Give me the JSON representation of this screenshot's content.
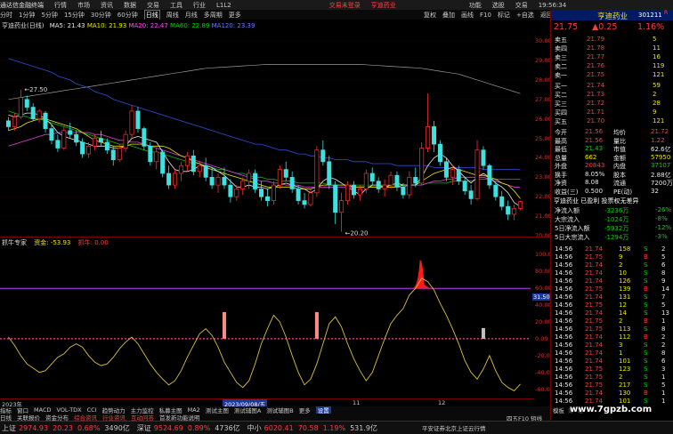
{
  "menubar": {
    "app": "通达信金融终端",
    "items": [
      "行情",
      "市场",
      "资讯",
      "数据",
      "交易",
      "工具",
      "行业",
      "L1L2"
    ],
    "center": "交易未登录",
    "center2": "亨迪药业",
    "right": [
      "功能",
      "选股",
      "交易"
    ],
    "clock": "19:56:34"
  },
  "toolbar": {
    "items": [
      "分时",
      "1分钟",
      "5分钟",
      "15分钟",
      "30分钟",
      "60分钟",
      "日线",
      "周线",
      "月线",
      "多周期",
      "更多"
    ],
    "active": "日线"
  },
  "toolbar2": {
    "items": [
      "复权",
      "叠加",
      "画线",
      "F10",
      "标记",
      "+自选",
      "返回"
    ]
  },
  "main_legend": {
    "name": "亨迪药业(日线)",
    "ma5": "MA5: 21.43",
    "ma10": "MA10: 21.93",
    "ma20": "MA20: 22.47",
    "ma60": "MA60: 22.89",
    "ma120": "MA120: 23.39"
  },
  "price_axis": [
    "30.00",
    "29.00",
    "28.00",
    "27.00",
    "26.00",
    "25.00",
    "24.00",
    "23.00",
    "22.00",
    "21.00",
    "20.00"
  ],
  "annotations": {
    "high": "27.50",
    "low": "20.20"
  },
  "sub_legend": {
    "name": "抓牛专家",
    "v1": "资金: -53.93",
    "v2": "抓牛: 0.00"
  },
  "sub_axis": [
    "100.00",
    "80.00",
    "60.00",
    "40.00",
    "20.00",
    "0.00",
    "-20.00",
    "-40.00",
    "-60.00"
  ],
  "sub_marker": "31.50",
  "date_axis": {
    "year": "2023年",
    "mid": "2023/09/08/五",
    "m11": "11",
    "m12": "12"
  },
  "rp": {
    "name": "亨迪药业",
    "code": "301211",
    "r_badge": "R",
    "price": "21.75",
    "change": "▲0.25",
    "pct": "1.16%",
    "asks": [
      [
        "卖五",
        "21.79",
        "5"
      ],
      [
        "卖四",
        "21.78",
        "11"
      ],
      [
        "卖三",
        "21.77",
        "16"
      ],
      [
        "卖二",
        "21.76",
        "119"
      ],
      [
        "卖一",
        "21.75",
        "121"
      ]
    ],
    "bids": [
      [
        "买一",
        "21.74",
        "59"
      ],
      [
        "买二",
        "21.73",
        "2"
      ],
      [
        "买三",
        "21.72",
        "28"
      ],
      [
        "买四",
        "21.71",
        "9"
      ],
      [
        "买五",
        "21.70",
        "121"
      ]
    ],
    "stats": [
      [
        "今开",
        "21.56",
        "均价",
        "21.72"
      ],
      [
        "最高",
        "21.56",
        "量比",
        "1.22"
      ],
      [
        "最低",
        "21.43",
        "市值",
        "62.6亿"
      ],
      [
        "总量",
        "662",
        "金额",
        "57950"
      ],
      [
        "外盘",
        "20843",
        "内盘",
        "37107"
      ],
      [
        "换手",
        "8.05%",
        "股本",
        "2.88亿"
      ],
      [
        "净资",
        "8.08",
        "流通",
        "7200万"
      ],
      [
        "收益(三)",
        "0.500",
        "PE(动)",
        "32"
      ]
    ],
    "flow_header": "亨迪药业 已盈利 投票权无差异",
    "flows": [
      [
        "净流入额",
        "-3236万",
        "-26%"
      ],
      [
        "大宗流入",
        "-1024万",
        "-8%"
      ],
      [
        "5日净流入额",
        "-5932万",
        "-12%"
      ],
      [
        "5日大宗流入",
        "-1294万",
        "-3%"
      ]
    ],
    "ticks": [
      [
        "14:56",
        "21.74",
        "158",
        "S",
        "2"
      ],
      [
        "14:56",
        "21.75",
        "9",
        "B",
        "5"
      ],
      [
        "14:56",
        "21.74",
        "2",
        "S",
        "6"
      ],
      [
        "14:56",
        "21.74",
        "10",
        "S",
        "8"
      ],
      [
        "14:56",
        "21.74",
        "126",
        "S",
        "9"
      ],
      [
        "14:56",
        "21.75",
        "139",
        "B",
        "14"
      ],
      [
        "14:56",
        "21.74",
        "131",
        "S",
        "7"
      ],
      [
        "14:56",
        "21.75",
        "12",
        "S",
        "5"
      ],
      [
        "14:56",
        "21.74",
        "14",
        "S",
        "13"
      ],
      [
        "14:56",
        "21.75",
        "2",
        "B",
        "1"
      ],
      [
        "14:56",
        "21.75",
        "113",
        "S",
        "8"
      ],
      [
        "14:56",
        "21.74",
        "112",
        "B",
        "2"
      ],
      [
        "14:56",
        "21.74",
        "3",
        "S",
        "2"
      ],
      [
        "14:56",
        "21.74",
        "1",
        "S",
        "8"
      ],
      [
        "14:56",
        "21.74",
        "101",
        "S",
        "6"
      ],
      [
        "14:56",
        "21.75",
        "123",
        "S",
        "3"
      ],
      [
        "14:56",
        "21.75",
        "2",
        "S",
        "1"
      ],
      [
        "14:56",
        "21.75",
        "217",
        "S",
        "5"
      ],
      [
        "14:56",
        "21.74",
        "130",
        "B",
        "1"
      ],
      [
        "14:56",
        "21.74",
        "101",
        "S",
        "1"
      ]
    ],
    "tabs": [
      "模板",
      "筹",
      "笔"
    ]
  },
  "bottom1": {
    "items": [
      "指标",
      "窗口",
      "MACD",
      "VOL-TDX",
      "CCI",
      "趋势动力",
      "主力监控",
      "私募主图",
      "MA2",
      "测试主图",
      "测试辅图A",
      "测试辅图B",
      "更多",
      "设置"
    ]
  },
  "bottom2": {
    "items": [
      "日线",
      "关联报价",
      "资金分布",
      "综合资讯",
      "行业资讯",
      "互动问答",
      "首发新功能说明"
    ],
    "right": "四五F10 短线"
  },
  "status": {
    "sh_label": "上证",
    "sh_val": "2974.93",
    "sh_chg": "20.23",
    "sh_pct": "0.68%",
    "sh_amt": "3490亿",
    "sz_label": "深证",
    "sz_val": "9524.69",
    "sz_pct": "0.89%",
    "sz_amt": "4736亿",
    "zx_label": "中小",
    "zx_val": "6020.41",
    "zx_chg": "70.58",
    "zx_pct": "1.19%",
    "zx_amt": "531.9亿",
    "right": "平安证券北京上证云行情"
  },
  "watermark": "www.7gpzb.com",
  "chart_data": {
    "type": "candlestick",
    "title": "亨迪药业(日线)",
    "ylim": [
      20.0,
      30.6
    ],
    "candles": [
      [
        25.9,
        26.1,
        25.4,
        25.6
      ],
      [
        25.6,
        26.3,
        25.4,
        26.1
      ],
      [
        26.1,
        27.5,
        26.0,
        27.1
      ],
      [
        27.0,
        27.2,
        26.4,
        26.6
      ],
      [
        26.6,
        26.8,
        25.9,
        26.0
      ],
      [
        26.0,
        26.5,
        25.8,
        26.4
      ],
      [
        26.3,
        26.4,
        25.3,
        25.5
      ],
      [
        25.5,
        25.7,
        24.7,
        24.9
      ],
      [
        24.9,
        25.2,
        24.3,
        24.5
      ],
      [
        24.5,
        25.6,
        24.4,
        25.4
      ],
      [
        25.4,
        25.8,
        25.0,
        25.2
      ],
      [
        25.2,
        25.4,
        24.6,
        24.8
      ],
      [
        24.8,
        25.0,
        24.0,
        24.2
      ],
      [
        24.2,
        24.8,
        24.0,
        24.6
      ],
      [
        24.6,
        25.2,
        24.4,
        25.0
      ],
      [
        25.0,
        25.4,
        24.6,
        24.8
      ],
      [
        24.8,
        25.0,
        24.2,
        24.4
      ],
      [
        24.4,
        24.6,
        23.6,
        23.9
      ],
      [
        23.9,
        24.7,
        23.8,
        24.5
      ],
      [
        24.5,
        25.4,
        24.3,
        25.2
      ],
      [
        25.2,
        26.7,
        25.0,
        26.4
      ],
      [
        26.4,
        26.6,
        25.3,
        25.5
      ],
      [
        25.5,
        25.6,
        24.4,
        24.6
      ],
      [
        24.6,
        24.8,
        23.6,
        23.8
      ],
      [
        23.8,
        24.5,
        23.4,
        24.3
      ],
      [
        24.3,
        24.4,
        23.0,
        23.2
      ],
      [
        23.2,
        23.6,
        22.4,
        22.6
      ],
      [
        22.6,
        23.4,
        22.4,
        23.2
      ],
      [
        23.2,
        23.8,
        22.8,
        23.6
      ],
      [
        23.6,
        24.3,
        23.3,
        24.1
      ],
      [
        24.1,
        24.4,
        23.1,
        23.3
      ],
      [
        23.3,
        23.8,
        23.0,
        23.6
      ],
      [
        23.6,
        24.0,
        22.8,
        23.0
      ],
      [
        23.0,
        23.5,
        22.4,
        22.6
      ],
      [
        22.6,
        23.2,
        22.2,
        23.0
      ],
      [
        23.0,
        23.5,
        22.4,
        22.6
      ],
      [
        22.6,
        22.9,
        21.7,
        22.0
      ],
      [
        22.0,
        22.6,
        21.8,
        22.4
      ],
      [
        22.4,
        23.0,
        22.1,
        22.8
      ],
      [
        22.8,
        23.4,
        22.4,
        23.2
      ],
      [
        23.2,
        23.4,
        22.2,
        22.4
      ],
      [
        22.4,
        22.8,
        21.8,
        22.0
      ],
      [
        22.0,
        22.4,
        21.5,
        21.8
      ],
      [
        21.8,
        22.8,
        21.6,
        22.6
      ],
      [
        22.6,
        23.6,
        22.4,
        23.4
      ],
      [
        23.4,
        23.8,
        22.8,
        23.0
      ],
      [
        23.0,
        23.3,
        22.2,
        22.4
      ],
      [
        22.4,
        22.6,
        21.6,
        21.8
      ],
      [
        21.8,
        22.2,
        21.4,
        21.6
      ],
      [
        21.6,
        22.4,
        21.5,
        22.2
      ],
      [
        22.2,
        24.6,
        22.0,
        24.4
      ],
      [
        24.4,
        24.9,
        23.6,
        23.8
      ],
      [
        23.8,
        24.1,
        22.4,
        22.6
      ],
      [
        22.6,
        22.8,
        20.6,
        21.2
      ],
      [
        21.2,
        22.2,
        20.2,
        21.8
      ],
      [
        21.8,
        22.8,
        21.6,
        22.6
      ],
      [
        22.6,
        22.8,
        21.9,
        22.1
      ],
      [
        22.1,
        22.6,
        21.8,
        22.4
      ],
      [
        22.4,
        23.4,
        22.2,
        23.2
      ],
      [
        23.2,
        23.5,
        22.6,
        22.8
      ],
      [
        22.8,
        23.0,
        22.2,
        22.4
      ],
      [
        22.4,
        22.9,
        22.0,
        22.6
      ],
      [
        22.6,
        23.3,
        22.4,
        23.1
      ],
      [
        23.1,
        23.3,
        22.3,
        22.5
      ],
      [
        22.5,
        22.7,
        21.9,
        22.1
      ],
      [
        22.1,
        23.3,
        21.9,
        23.0
      ],
      [
        23.0,
        23.5,
        22.5,
        22.7
      ],
      [
        22.7,
        24.8,
        22.6,
        24.5
      ],
      [
        24.5,
        27.3,
        24.3,
        25.6
      ],
      [
        25.6,
        25.9,
        24.3,
        24.7
      ],
      [
        24.7,
        24.9,
        23.6,
        23.8
      ],
      [
        23.8,
        24.0,
        22.8,
        23.0
      ],
      [
        23.0,
        23.6,
        22.6,
        23.4
      ],
      [
        23.4,
        23.6,
        22.6,
        22.8
      ],
      [
        22.8,
        23.0,
        22.1,
        22.3
      ],
      [
        22.3,
        22.6,
        21.6,
        21.9
      ],
      [
        21.9,
        24.9,
        21.8,
        24.4
      ],
      [
        24.4,
        24.6,
        23.4,
        23.6
      ],
      [
        23.6,
        23.7,
        22.4,
        22.6
      ],
      [
        22.6,
        22.8,
        21.8,
        22.0
      ],
      [
        22.0,
        22.3,
        21.3,
        21.5
      ],
      [
        21.5,
        21.8,
        20.8,
        21.1
      ],
      [
        21.1,
        21.6,
        20.8,
        21.4
      ],
      [
        21.4,
        21.8,
        21.3,
        21.75
      ]
    ],
    "ma5": [
      26.2,
      26.1,
      26.2,
      26.3,
      26.3,
      26.2,
      26.0,
      25.7,
      25.3,
      25.1,
      25.0,
      24.9,
      24.8,
      24.7,
      24.6,
      24.6,
      24.6,
      24.5,
      24.5,
      24.6,
      25.0,
      25.1,
      25.0,
      24.9,
      24.8,
      24.3,
      23.8,
      23.4,
      23.3,
      23.3,
      23.4,
      23.6,
      23.6,
      23.5,
      23.3,
      23.1,
      22.8,
      22.5,
      22.5,
      22.6,
      22.5,
      22.5,
      22.4,
      22.5,
      22.6,
      22.7,
      22.6,
      22.5,
      22.4,
      22.2,
      22.4,
      22.8,
      23.0,
      22.9,
      22.7,
      22.5,
      22.3,
      22.1,
      22.4,
      22.6,
      22.6,
      22.5,
      22.6,
      22.7,
      22.6,
      22.6,
      22.6,
      23.0,
      23.6,
      24.0,
      24.2,
      24.0,
      23.6,
      23.3,
      23.0,
      22.7,
      23.0,
      23.2,
      23.0,
      22.7,
      22.5,
      22.2,
      21.7,
      21.5
    ],
    "ma10": [
      25.4,
      25.5,
      25.6,
      25.8,
      25.9,
      26.0,
      26.0,
      25.9,
      25.8,
      25.7,
      25.6,
      25.5,
      25.3,
      25.1,
      24.9,
      24.8,
      24.7,
      24.6,
      24.6,
      24.6,
      24.7,
      24.7,
      24.7,
      24.6,
      24.6,
      24.6,
      24.5,
      24.3,
      24.1,
      24.0,
      23.8,
      23.7,
      23.5,
      23.4,
      23.3,
      23.2,
      23.1,
      23.0,
      22.9,
      22.8,
      22.7,
      22.6,
      22.5,
      22.5,
      22.5,
      22.5,
      22.5,
      22.4,
      22.4,
      22.4,
      22.5,
      22.6,
      22.6,
      22.6,
      22.6,
      22.6,
      22.5,
      22.5,
      22.5,
      22.5,
      22.5,
      22.5,
      22.5,
      22.5,
      22.6,
      22.6,
      22.6,
      22.8,
      23.0,
      23.2,
      23.3,
      23.4,
      23.5,
      23.4,
      23.3,
      23.2,
      23.1,
      23.1,
      23.0,
      22.9,
      22.7,
      22.6,
      22.3,
      21.9
    ],
    "ma20": [
      24.6,
      24.7,
      24.8,
      24.9,
      25.0,
      25.1,
      25.2,
      25.2,
      25.3,
      25.3,
      25.3,
      25.3,
      25.3,
      25.3,
      25.2,
      25.2,
      25.1,
      25.0,
      24.9,
      24.9,
      24.8,
      24.8,
      24.7,
      24.6,
      24.5,
      24.4,
      24.3,
      24.2,
      24.1,
      24.0,
      23.9,
      23.8,
      23.7,
      23.6,
      23.5,
      23.4,
      23.3,
      23.2,
      23.1,
      23.0,
      22.9,
      22.8,
      22.8,
      22.7,
      22.7,
      22.6,
      22.6,
      22.6,
      22.5,
      22.5,
      22.5,
      22.5,
      22.5,
      22.5,
      22.5,
      22.5,
      22.5,
      22.5,
      22.5,
      22.5,
      22.5,
      22.5,
      22.5,
      22.5,
      22.5,
      22.6,
      22.6,
      22.6,
      22.7,
      22.8,
      22.8,
      22.9,
      22.9,
      23.0,
      23.0,
      23.0,
      23.0,
      23.0,
      22.9,
      22.8,
      22.7,
      22.6,
      22.5,
      22.47
    ],
    "ma60": [
      26.4,
      26.3,
      26.2,
      26.1,
      26.0,
      26.0,
      25.9,
      25.8,
      25.7,
      25.6,
      25.5,
      25.4,
      25.3,
      25.2,
      25.1,
      25.0,
      24.9,
      24.8,
      24.7,
      24.7,
      24.6,
      24.5,
      24.4,
      24.3,
      24.3,
      24.2,
      24.1,
      24.0,
      23.9,
      23.8,
      23.7,
      23.7,
      23.6,
      23.5,
      23.4,
      23.4,
      23.3,
      23.2,
      23.2,
      23.1,
      23.0,
      23.0,
      22.9,
      22.9,
      22.8,
      22.8,
      22.8,
      22.7,
      22.7,
      22.7,
      22.7,
      22.7,
      22.6,
      22.6,
      22.6,
      22.6,
      22.6,
      22.6,
      22.6,
      22.6,
      22.6,
      22.6,
      22.6,
      22.6,
      22.6,
      22.6,
      22.6,
      22.6,
      22.7,
      22.7,
      22.7,
      22.7,
      22.8,
      22.8,
      22.8,
      22.8,
      22.9,
      22.9,
      22.9,
      22.9,
      22.9,
      22.9,
      22.9,
      22.89
    ],
    "ma120": [
      29.1,
      29.0,
      28.9,
      28.8,
      28.7,
      28.6,
      28.5,
      28.4,
      28.2,
      28.1,
      28.0,
      27.8,
      27.7,
      27.6,
      27.4,
      27.3,
      27.2,
      27.0,
      26.9,
      26.8,
      26.7,
      26.6,
      26.5,
      26.4,
      26.3,
      26.2,
      26.1,
      26.0,
      25.9,
      25.8,
      25.7,
      25.6,
      25.5,
      25.4,
      25.3,
      25.2,
      25.1,
      25.0,
      24.9,
      24.8,
      24.7,
      24.7,
      24.6,
      24.5,
      24.4,
      24.4,
      24.3,
      24.2,
      24.2,
      24.1,
      24.1,
      24.0,
      24.0,
      23.9,
      23.9,
      23.9,
      23.8,
      23.8,
      23.8,
      23.7,
      23.7,
      23.7,
      23.7,
      23.6,
      23.6,
      23.6,
      23.6,
      23.6,
      23.6,
      23.5,
      23.5,
      23.5,
      23.5,
      23.5,
      23.5,
      23.5,
      23.5,
      23.4,
      23.4,
      23.4,
      23.4,
      23.4,
      23.4,
      23.39
    ],
    "ma250": [
      27.0,
      27.05,
      27.1,
      27.15,
      27.2,
      27.25,
      27.3,
      27.35,
      27.4,
      27.45,
      27.5,
      27.55,
      27.6,
      27.65,
      27.7,
      27.75,
      27.8,
      27.85,
      27.9,
      27.95,
      28.0,
      28.05,
      28.1,
      28.15,
      28.2,
      28.25,
      28.3,
      28.35,
      28.4,
      28.45,
      28.5,
      28.55,
      28.6,
      28.62,
      28.64,
      28.66,
      28.68,
      28.7,
      28.72,
      28.74,
      28.76,
      28.78,
      28.8,
      28.8,
      28.8,
      28.8,
      28.8,
      28.8,
      28.8,
      28.8,
      28.8,
      28.8,
      28.8,
      28.8,
      28.8,
      28.8,
      28.8,
      28.8,
      28.78,
      28.76,
      28.74,
      28.72,
      28.7,
      28.68,
      28.66,
      28.64,
      28.62,
      28.6,
      28.55,
      28.5,
      28.45,
      28.4,
      28.35,
      28.3,
      28.2,
      28.1,
      28.0,
      27.9,
      27.8,
      27.7,
      27.6,
      27.5,
      27.4,
      27.3
    ],
    "sub": {
      "ylim": [
        -70,
        110
      ],
      "line": [
        2,
        -8,
        -20,
        -30,
        -35,
        -40,
        -38,
        -30,
        -22,
        -18,
        -10,
        -6,
        -10,
        -20,
        -28,
        -32,
        -30,
        -22,
        -12,
        -4,
        2,
        -6,
        -18,
        -30,
        -40,
        -48,
        -55,
        -50,
        -38,
        -22,
        -8,
        6,
        12,
        4,
        -10,
        -28,
        -40,
        -52,
        -58,
        -50,
        -30,
        -6,
        12,
        28,
        20,
        2,
        -20,
        -40,
        -55,
        -48,
        -30,
        -6,
        18,
        26,
        14,
        -6,
        -24,
        -38,
        -50,
        -40,
        -20,
        0,
        18,
        28,
        36,
        52,
        60,
        72,
        68,
        58,
        42,
        28,
        12,
        -6,
        -26,
        -40,
        -48,
        -36,
        -20,
        -38,
        -52,
        -58,
        -62,
        -54
      ],
      "red_bars": [
        {
          "i": 35,
          "v": 12
        },
        {
          "i": 50,
          "v": 12
        },
        {
          "i": 77,
          "v": 12
        }
      ],
      "peak": {
        "i": 67,
        "h": 94
      },
      "hline_magenta": 60,
      "hline_dotted": 0
    }
  }
}
